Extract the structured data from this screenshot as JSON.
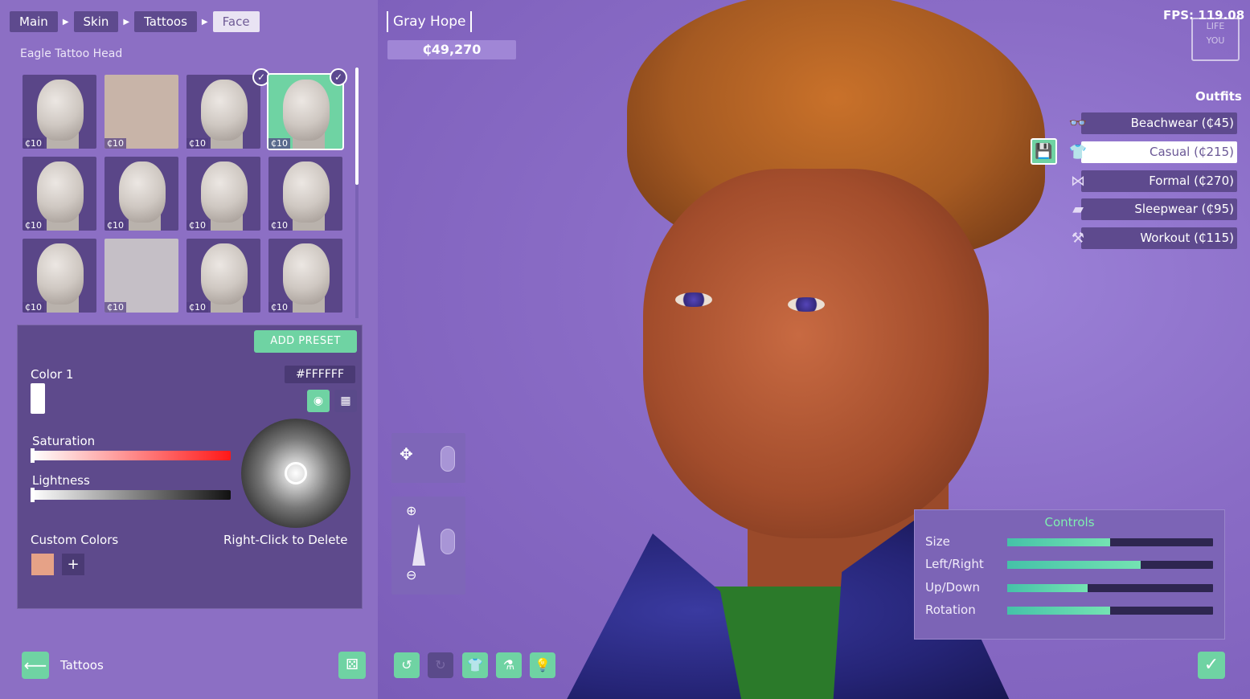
{
  "breadcrumb": {
    "items": [
      "Main",
      "Skin",
      "Tattoos",
      "Face"
    ]
  },
  "tattoo_section": {
    "title": "Eagle Tattoo Head",
    "tiles": [
      {
        "price": "₵10",
        "checked": false
      },
      {
        "price": "₵10",
        "checked": false
      },
      {
        "price": "₵10",
        "checked": true
      },
      {
        "price": "₵10",
        "checked": true
      },
      {
        "price": "₵10",
        "checked": false
      },
      {
        "price": "₵10",
        "checked": false
      },
      {
        "price": "₵10",
        "checked": false
      },
      {
        "price": "₵10",
        "checked": false
      },
      {
        "price": "₵10",
        "checked": false
      },
      {
        "price": "₵10",
        "checked": false
      },
      {
        "price": "₵10",
        "checked": false
      },
      {
        "price": "₵10",
        "checked": false
      }
    ]
  },
  "color_panel": {
    "add_preset": "ADD PRESET",
    "color_label": "Color 1",
    "hex_value": "#FFFFFF",
    "saturation_label": "Saturation",
    "lightness_label": "Lightness",
    "custom_colors_label": "Custom Colors",
    "delete_hint": "Right-Click to Delete",
    "plus": "+",
    "custom_swatch_color": "#e6a287",
    "accent_color": "#6fd3a3"
  },
  "footer_left": {
    "back_label": "Tattoos"
  },
  "character": {
    "name": "Gray Hope",
    "money": "₵49,270"
  },
  "hud": {
    "fps": "FPS: 119.08",
    "logo_top": "LIFE",
    "logo_bottom": "YOU"
  },
  "outfits": {
    "title": "Outfits",
    "items": [
      {
        "label": "Beachwear (₵45)",
        "icon": "sunglasses-icon",
        "active": false
      },
      {
        "label": "Casual (₵215)",
        "icon": "tshirt-icon",
        "active": true
      },
      {
        "label": "Formal (₵270)",
        "icon": "bowtie-icon",
        "active": false
      },
      {
        "label": "Sleepwear (₵95)",
        "icon": "pillow-icon",
        "active": false
      },
      {
        "label": "Workout (₵115)",
        "icon": "dumbbell-icon",
        "active": false
      }
    ]
  },
  "controls": {
    "title": "Controls",
    "items": [
      {
        "label": "Size",
        "value": 0.5
      },
      {
        "label": "Left/Right",
        "value": 0.65
      },
      {
        "label": "Up/Down",
        "value": 0.39
      },
      {
        "label": "Rotation",
        "value": 0.5
      }
    ]
  }
}
